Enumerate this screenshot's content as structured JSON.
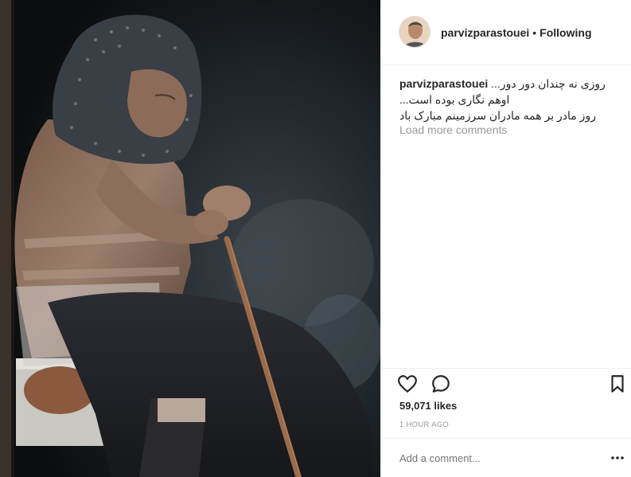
{
  "post": {
    "image_alt": "Elderly woman in headscarf seated holding a wooden cane",
    "username": "parvizparastouei",
    "follow_status": "Following",
    "separator": "•",
    "caption_lines": [
      "روزی نه چندان دور دور...",
      "اوهم نگاری بوده است...",
      "روز مادر بر همه مادران سرزمینم مبارک باد"
    ],
    "load_more": "Load more comments",
    "likes": "59,071 likes",
    "time": "1 HOUR AGO",
    "comment_placeholder": "Add a comment..."
  },
  "icons": {
    "like": "heart-icon",
    "comment": "comment-bubble-icon",
    "save": "bookmark-icon",
    "more": "more-options-icon"
  },
  "colors": {
    "text": "#262626",
    "muted": "#999999",
    "border": "#efefef"
  }
}
